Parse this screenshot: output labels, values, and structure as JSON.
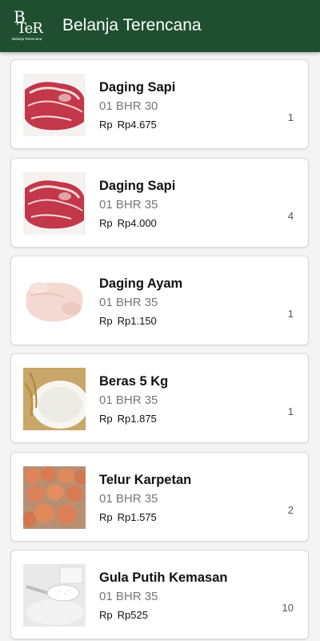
{
  "app": {
    "title": "Belanja Terencana",
    "logo_big": "BTeR",
    "logo_small": "Belanja Terencana"
  },
  "items": [
    {
      "name": "Daging Sapi",
      "code": "01 BHR 30",
      "currency": "Rp",
      "price": "Rp4.675",
      "qty": "1",
      "image": "beef-image"
    },
    {
      "name": "Daging Sapi",
      "code": "01 BHR 35",
      "currency": "Rp",
      "price": "Rp4.000",
      "qty": "4",
      "image": "beef-image"
    },
    {
      "name": "Daging Ayam",
      "code": "01 BHR 35",
      "currency": "Rp",
      "price": "Rp1.150",
      "qty": "1",
      "image": "chicken-image"
    },
    {
      "name": "Beras 5 Kg",
      "code": "01 BHR 35",
      "currency": "Rp",
      "price": "Rp1.875",
      "qty": "1",
      "image": "rice-image"
    },
    {
      "name": "Telur Karpetan",
      "code": "01 BHR 35",
      "currency": "Rp",
      "price": "Rp1.575",
      "qty": "2",
      "image": "eggs-image"
    },
    {
      "name": "Gula Putih Kemasan",
      "code": "01 BHR 35",
      "currency": "Rp",
      "price": "Rp525",
      "qty": "10",
      "image": "sugar-image"
    }
  ]
}
